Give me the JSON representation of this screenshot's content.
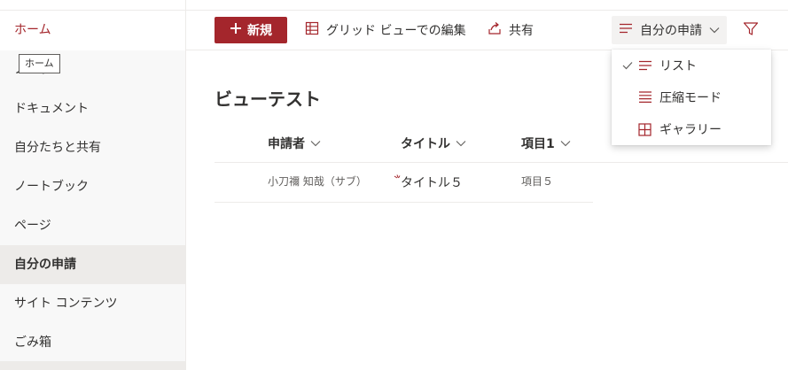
{
  "colors": {
    "accent": "#a4262c",
    "nav_bg": "#f8f8f8",
    "selected_bg": "#edebe9"
  },
  "sidebar": {
    "items": [
      {
        "label": "ホーム"
      },
      {
        "label": "ノード"
      },
      {
        "label": "ドキュメント"
      },
      {
        "label": "自分たちと共有"
      },
      {
        "label": "ノートブック"
      },
      {
        "label": "ページ"
      },
      {
        "label": "自分の申請"
      },
      {
        "label": "サイト コンテンツ"
      },
      {
        "label": "ごみ箱"
      }
    ],
    "tooltip": "ホーム"
  },
  "toolbar": {
    "new_label": "新規",
    "grid_edit_label": "グリッド ビューでの編集",
    "share_label": "共有",
    "view_label": "自分の申請",
    "filter_icon": "filter-icon"
  },
  "view_menu": {
    "items": [
      {
        "label": "リスト",
        "icon": "list-icon",
        "checked": true
      },
      {
        "label": "圧縮モード",
        "icon": "compact-icon",
        "checked": false
      },
      {
        "label": "ギャラリー",
        "icon": "gallery-icon",
        "checked": false
      }
    ]
  },
  "main": {
    "title": "ビューテスト",
    "columns": [
      {
        "label": "申請者"
      },
      {
        "label": "タイトル"
      },
      {
        "label": "項目1"
      }
    ],
    "rows": [
      {
        "applicant": "小刀禰 知哉（サブ）",
        "title": "タイトル５",
        "item1": "項目５"
      }
    ]
  }
}
